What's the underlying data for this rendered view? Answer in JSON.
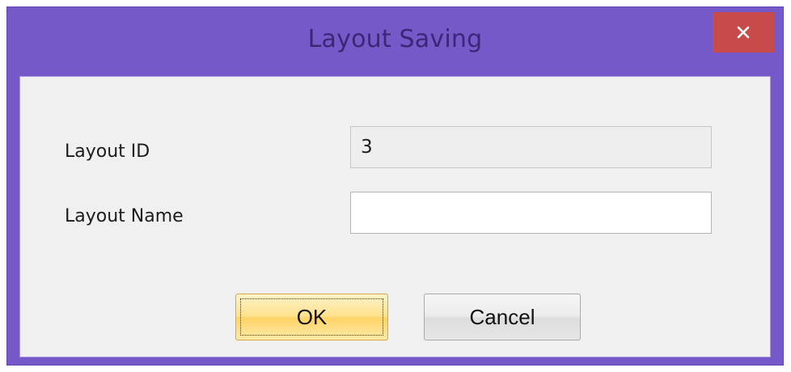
{
  "dialog": {
    "title": "Layout Saving",
    "close_icon": "close-icon",
    "fields": {
      "layout_id": {
        "label": "Layout  ID",
        "value": "3"
      },
      "layout_name": {
        "label": "Layout Name",
        "value": ""
      }
    },
    "buttons": {
      "ok_label": "OK",
      "cancel_label": "Cancel"
    }
  },
  "colors": {
    "titlebar": "#7559c9",
    "close_button": "#c94a4a",
    "ok_button": "#ffe28e"
  }
}
